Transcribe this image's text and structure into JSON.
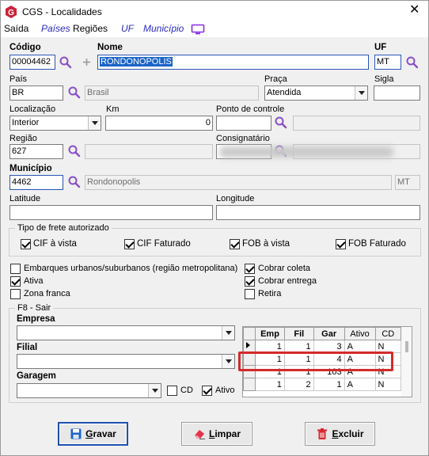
{
  "window": {
    "title": "CGS - Localidades",
    "close_glyph": "✕",
    "app_icon": "g-logo-icon"
  },
  "menu": {
    "items": [
      {
        "label": "Saída"
      },
      {
        "label": "Países"
      },
      {
        "label": "Regiões"
      },
      {
        "label": "UF"
      },
      {
        "label": "Município"
      }
    ],
    "monitor_icon": "monitor-icon"
  },
  "fields": {
    "codigo": {
      "label": "Código",
      "value": "00004462"
    },
    "nome": {
      "label": "Nome",
      "value": "RONDONOPOLIS"
    },
    "uf": {
      "label": "UF",
      "value": "MT"
    },
    "pais": {
      "label": "País",
      "code": "BR",
      "name": "Brasil"
    },
    "praca": {
      "label": "Praça",
      "value": "Atendida"
    },
    "sigla": {
      "label": "Sigla",
      "value": ""
    },
    "localizacao": {
      "label": "Localização",
      "value": "Interior"
    },
    "km": {
      "label": "Km",
      "value": "0"
    },
    "ponto_controle": {
      "label": "Ponto de controle",
      "value": "",
      "name": ""
    },
    "regiao": {
      "label": "Região",
      "code": "627",
      "name": ""
    },
    "consignatario": {
      "label": "Consignatário",
      "code": "",
      "name": ""
    },
    "municipio": {
      "label": "Município",
      "code": "4462",
      "name": "Rondonopolis",
      "uf": "MT"
    },
    "latitude": {
      "label": "Latitude",
      "value": ""
    },
    "longitude": {
      "label": "Longitude",
      "value": ""
    }
  },
  "frete": {
    "title": "Tipo de frete autorizado",
    "options": [
      {
        "label": "CIF à vista",
        "checked": true
      },
      {
        "label": "CIF Faturado",
        "checked": true
      },
      {
        "label": "FOB à vista",
        "checked": true
      },
      {
        "label": "FOB Faturado",
        "checked": true
      }
    ]
  },
  "flags": {
    "left": [
      {
        "label": "Embarques urbanos/suburbanos (região metropolitana)",
        "checked": false
      },
      {
        "label": "Ativa",
        "checked": true
      },
      {
        "label": "Zona franca",
        "checked": false
      }
    ],
    "right": [
      {
        "label": "Cobrar coleta",
        "checked": true
      },
      {
        "label": "Cobrar entrega",
        "checked": true
      },
      {
        "label": "Retira",
        "checked": false
      }
    ]
  },
  "garagem_group": {
    "title": "F8 - Sair",
    "empresa_label": "Empresa",
    "empresa_value": "",
    "filial_label": "Filial",
    "filial_value": "",
    "garagem_label": "Garagem",
    "garagem_value": "",
    "cd_label": "CD",
    "cd_checked": false,
    "ativo_label": "Ativo",
    "ativo_checked": true
  },
  "grid": {
    "columns": [
      "Emp",
      "Fil",
      "Gar",
      "Ativo",
      "CD"
    ],
    "rows": [
      {
        "emp": "1",
        "fil": "1",
        "gar": "3",
        "ativo": "A",
        "cd": "N",
        "current": true
      },
      {
        "emp": "1",
        "fil": "1",
        "gar": "4",
        "ativo": "A",
        "cd": "N",
        "current": false
      },
      {
        "emp": "1",
        "fil": "1",
        "gar": "103",
        "ativo": "A",
        "cd": "N",
        "current": false
      },
      {
        "emp": "1",
        "fil": "2",
        "gar": "1",
        "ativo": "A",
        "cd": "N",
        "current": false
      }
    ]
  },
  "buttons": {
    "gravar": {
      "label": "Gravar",
      "hotkey": "G",
      "rest": "ravar",
      "icon": "save-icon"
    },
    "limpar": {
      "label": "Limpar",
      "hotkey": "L",
      "rest": "impar",
      "icon": "eraser-icon"
    },
    "excluir": {
      "label": "Excluir",
      "hotkey": "E",
      "rest": "xcluir",
      "icon": "trash-icon"
    }
  },
  "colors": {
    "highlight": "#d42a2a",
    "link": "#2a2ac0",
    "selection": "#1b63c8"
  }
}
